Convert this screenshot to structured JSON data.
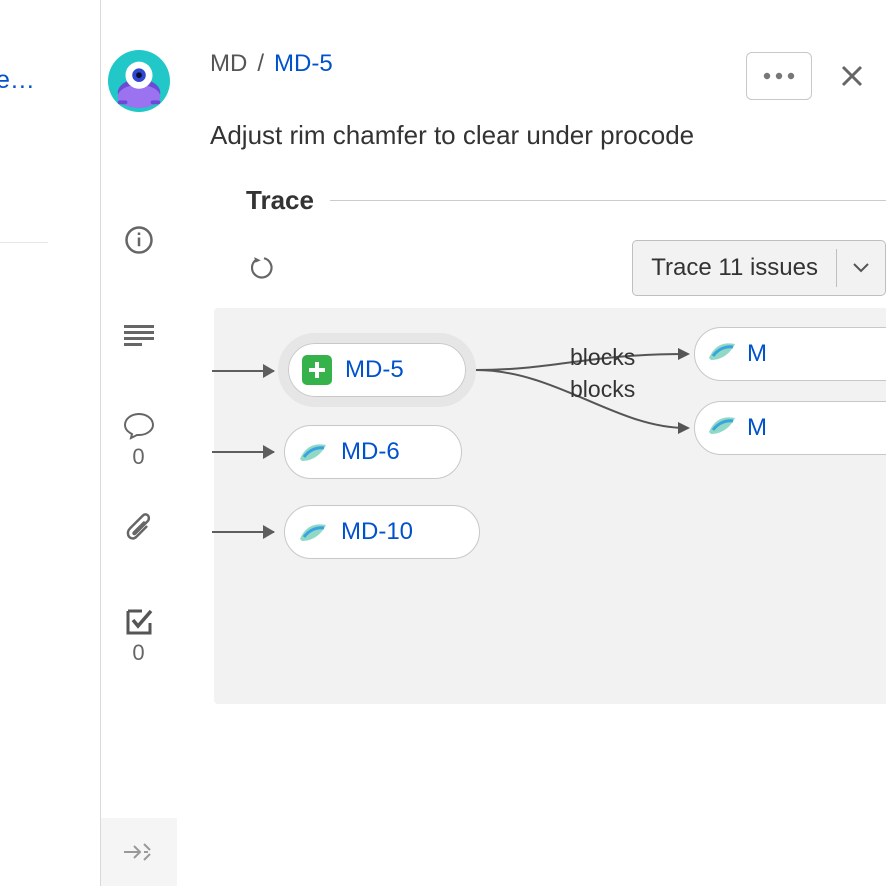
{
  "left_edge_label": "e…",
  "breadcrumb": {
    "project": "MD",
    "sep": "/",
    "issue": "MD-5"
  },
  "title": "Adjust rim chamfer to clear under procode",
  "section_label": "Trace",
  "trace_button": "Trace 11 issues",
  "sidebar": {
    "comment_count": "0",
    "approval_count": "0"
  },
  "graph": {
    "nodes": [
      {
        "key": "MD-5",
        "active": true,
        "icon": "plus"
      },
      {
        "key": "MD-6",
        "active": false,
        "icon": "leaf"
      },
      {
        "key": "MD-10",
        "active": false,
        "icon": "leaf"
      }
    ],
    "relations": [
      {
        "label": "blocks",
        "target_prefix": "M"
      },
      {
        "label": "blocks",
        "target_prefix": "M"
      }
    ]
  }
}
